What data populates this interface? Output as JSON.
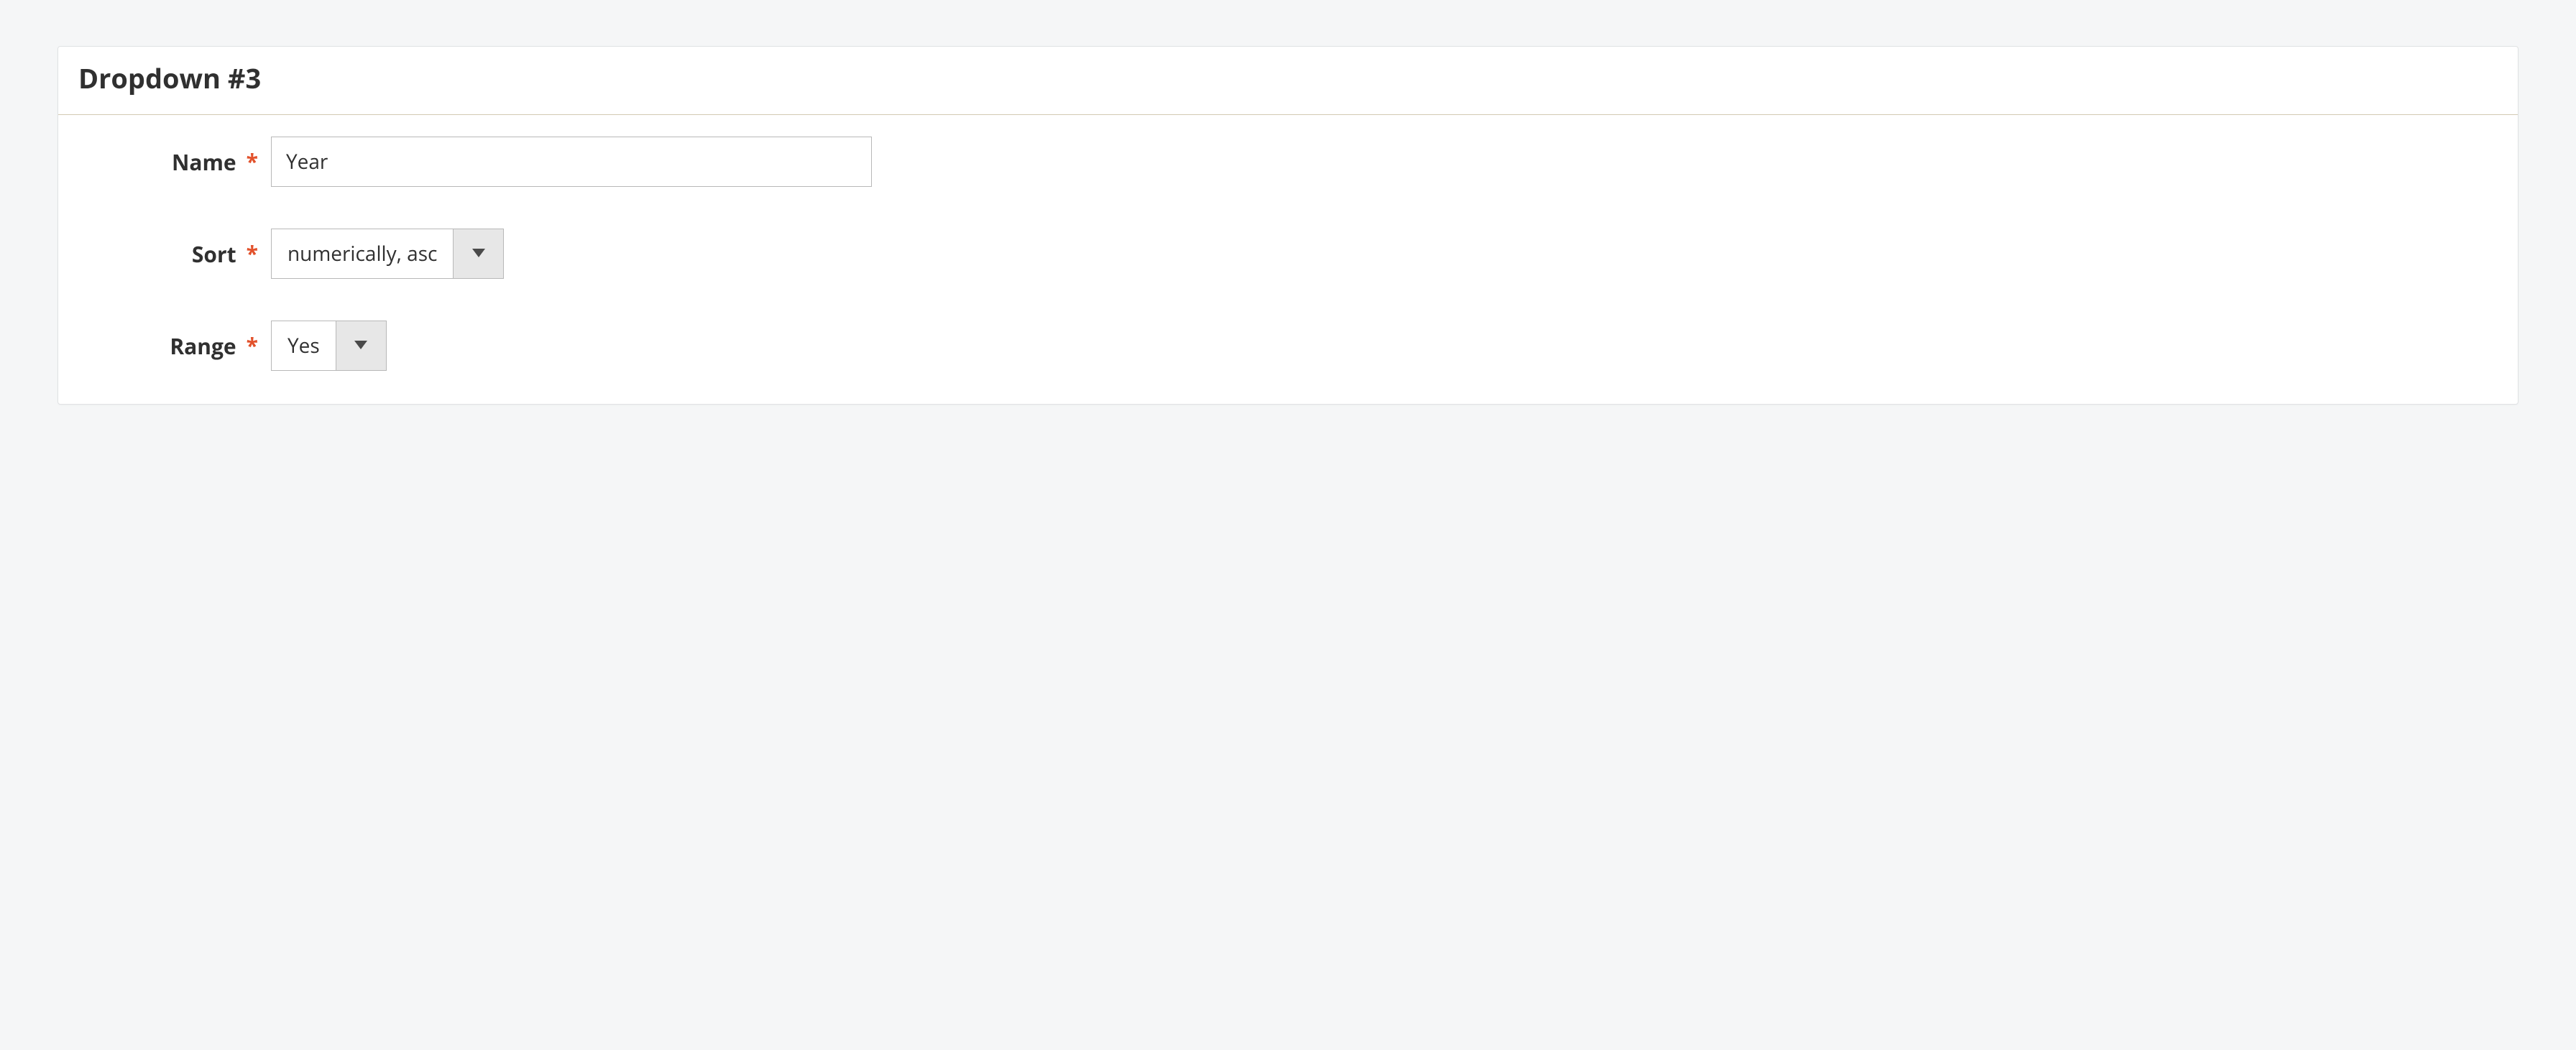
{
  "panel": {
    "title": "Dropdown #3"
  },
  "fields": {
    "name": {
      "label": "Name",
      "value": "Year",
      "required_marker": "*"
    },
    "sort": {
      "label": "Sort",
      "value": "numerically, asc",
      "required_marker": "*"
    },
    "range": {
      "label": "Range",
      "value": "Yes",
      "required_marker": "*"
    }
  }
}
